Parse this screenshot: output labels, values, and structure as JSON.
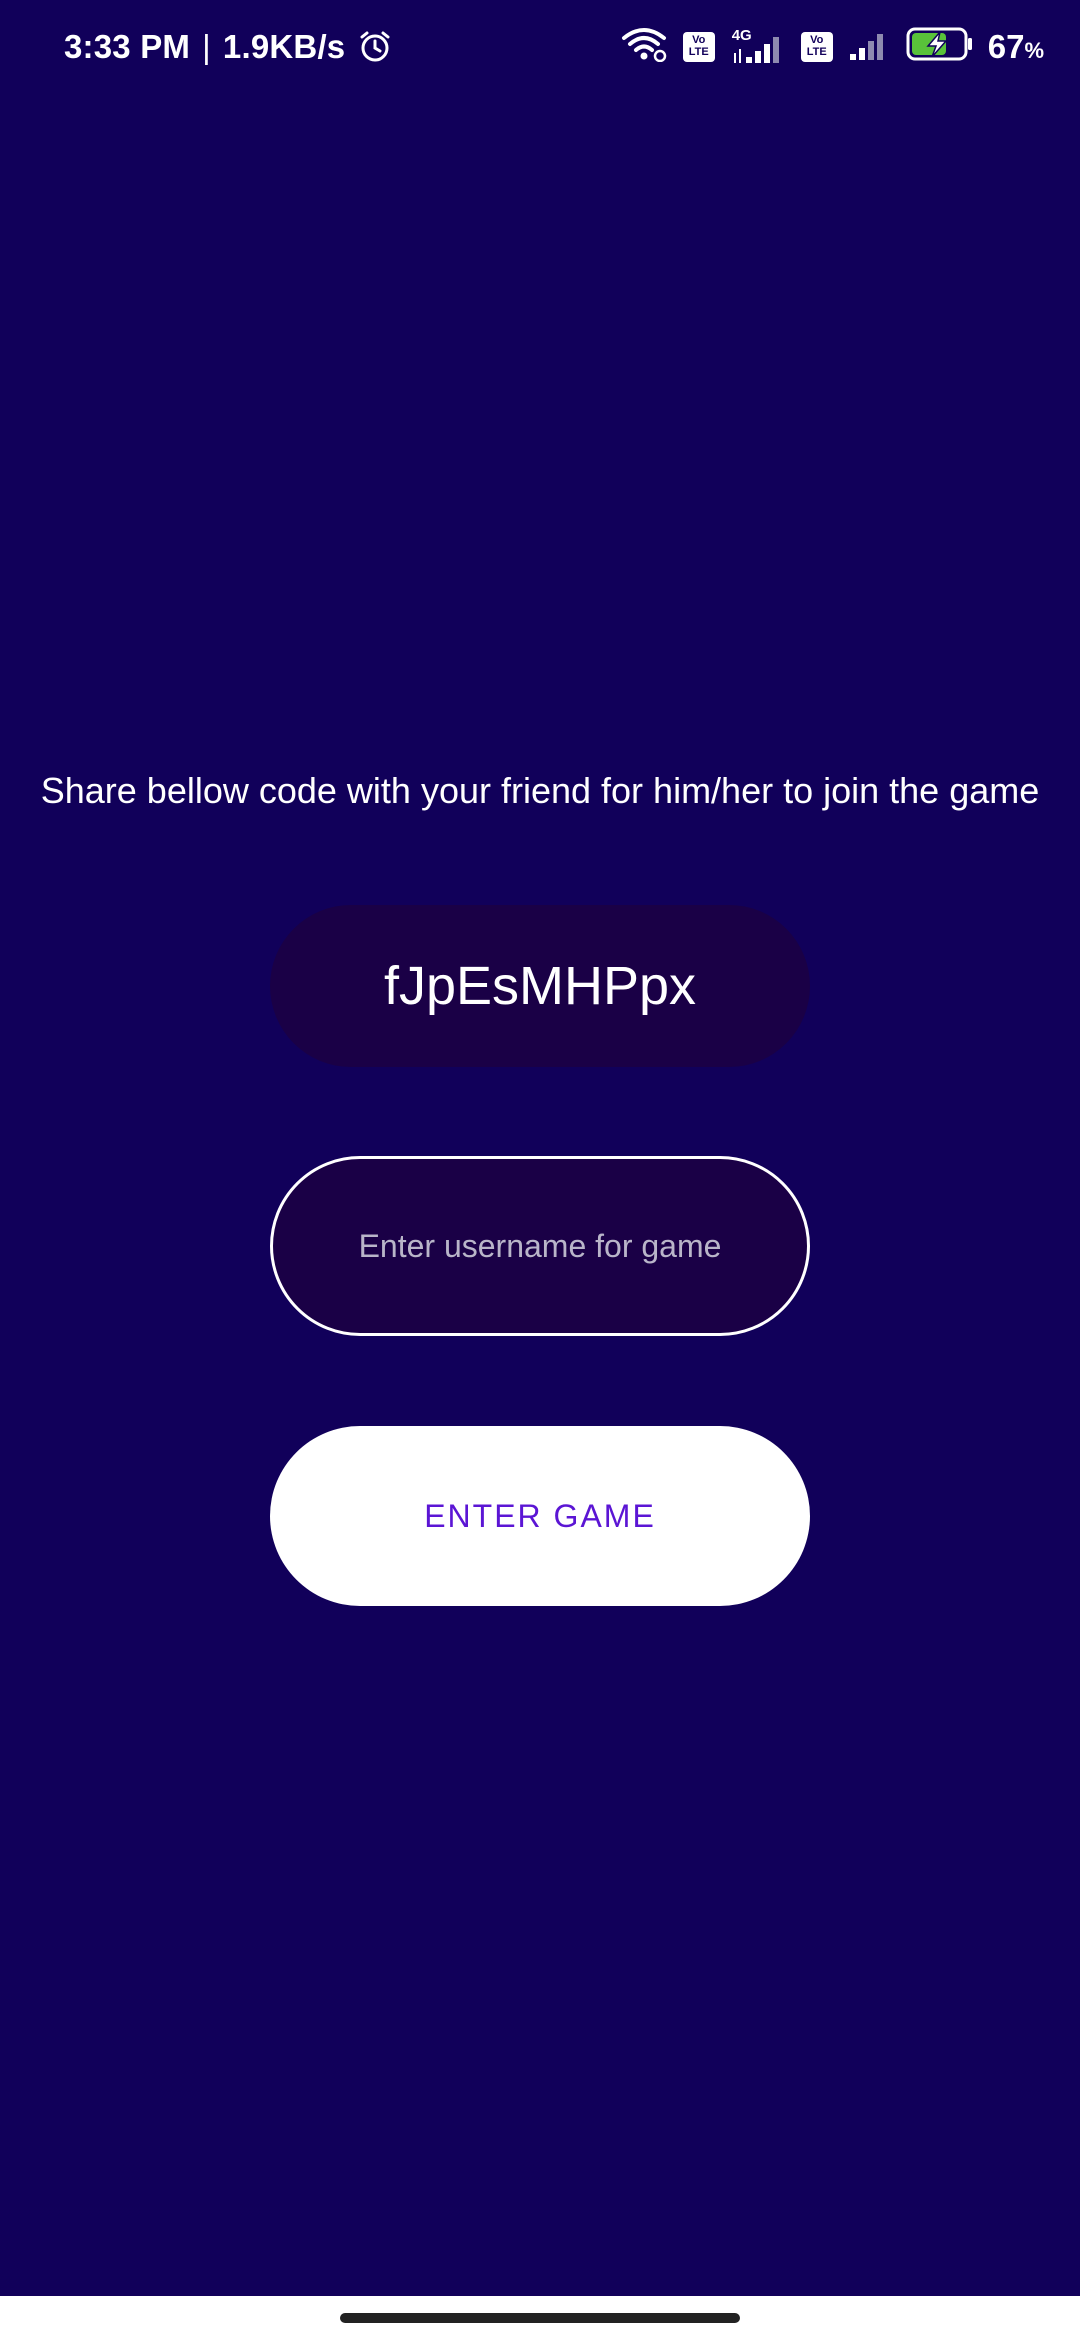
{
  "status_bar": {
    "time": "3:33 PM",
    "separator": "|",
    "network_speed": "1.9KB/s",
    "alarm_icon": "alarm-clock-icon",
    "wifi_icon": "wifi-icon",
    "volte1_label": "Vo LTE",
    "network_type": "4G",
    "volte2_label": "Vo LTE",
    "battery_icon": "battery-charging-icon",
    "battery_percent": "67",
    "battery_unit": "%",
    "battery_level": 0.67,
    "battery_color": "#59c23a"
  },
  "main": {
    "share_text": "Share bellow code with your friend for him/her to join the game",
    "game_code": "fJpEsMHPpx",
    "username_placeholder": "Enter username for game",
    "username_value": "",
    "enter_button_label": "ENTER GAME"
  },
  "colors": {
    "background": "#11005a",
    "pill_background": "#1a0046",
    "button_text": "#5b15d4"
  }
}
